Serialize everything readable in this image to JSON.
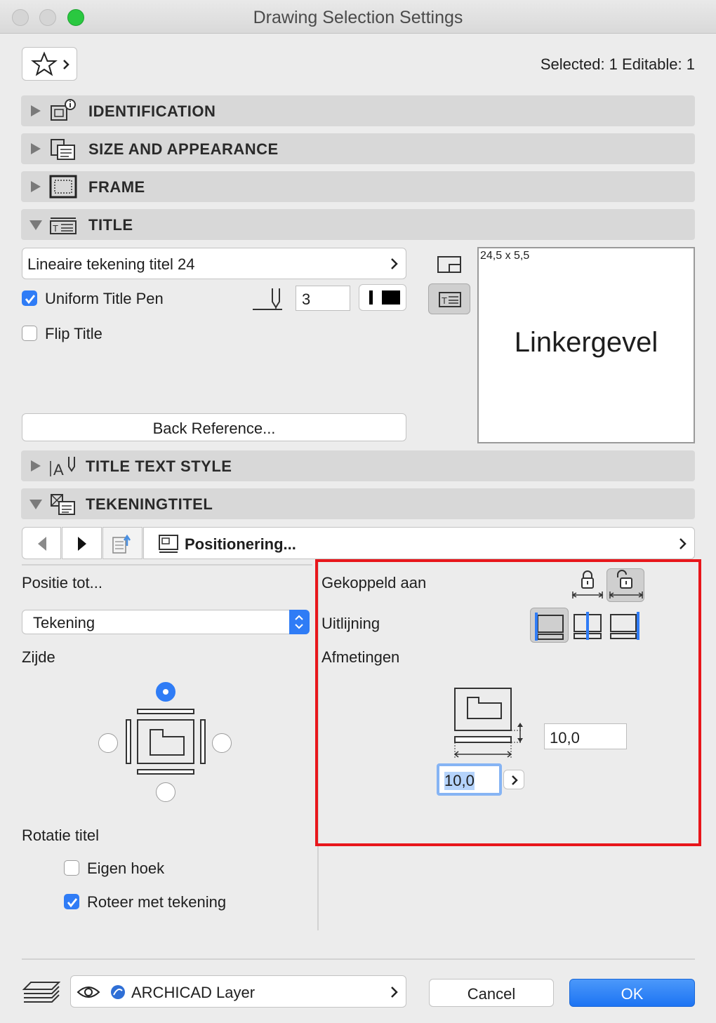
{
  "window": {
    "title": "Drawing Selection Settings"
  },
  "header": {
    "selection_info": "Selected: 1 Editable: 1"
  },
  "panels": {
    "identification": "IDENTIFICATION",
    "size_appearance": "SIZE AND APPEARANCE",
    "frame": "FRAME",
    "title": "TITLE",
    "title_text_style": "TITLE TEXT STYLE",
    "tekeningtitel": "TEKENINGTITEL"
  },
  "title_panel": {
    "title_type": "Lineaire tekening titel 24",
    "uniform_title_pen_label": "Uniform Title Pen",
    "uniform_title_pen_checked": true,
    "pen_value": "3",
    "flip_title_label": "Flip Title",
    "flip_title_checked": false,
    "back_reference_label": "Back Reference...",
    "preview_size": "24,5 x 5,5",
    "preview_text": "Linkergevel"
  },
  "tekeningtitel": {
    "page_label": "Positionering...",
    "positie_tot_label": "Positie tot...",
    "positie_value": "Tekening",
    "zijde_label": "Zijde",
    "selected_side": "top",
    "rotatie_label": "Rotatie titel",
    "eigen_hoek_label": "Eigen hoek",
    "eigen_hoek_checked": false,
    "roteer_label": "Roteer met tekening",
    "roteer_checked": true,
    "gekoppeld_label": "Gekoppeld aan",
    "uitlijning_label": "Uitlijning",
    "afmetingen_label": "Afmetingen",
    "offset_vertical": "10,0",
    "offset_horizontal": "10,0"
  },
  "footer": {
    "layer": "ARCHICAD Layer",
    "cancel_label": "Cancel",
    "ok_label": "OK"
  },
  "colors": {
    "accent": "#2f7cf6",
    "highlight_box": "#e8161b",
    "ok_button": "#2d83f7"
  }
}
